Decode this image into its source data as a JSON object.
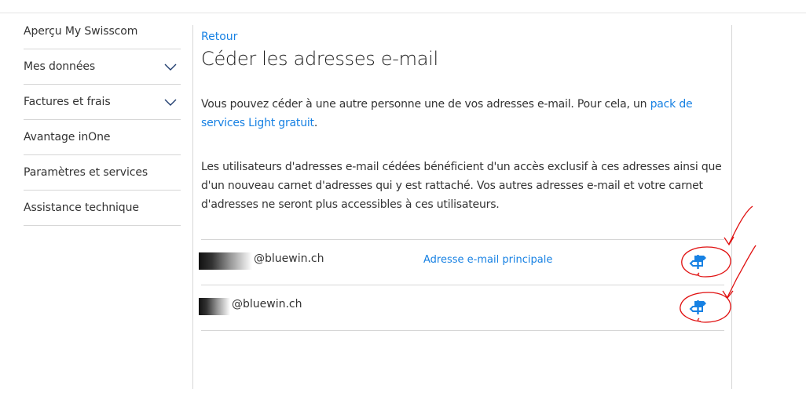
{
  "sidebar": {
    "items": [
      {
        "label": "Aperçu My Swisscom",
        "expandable": false
      },
      {
        "label": "Mes données",
        "expandable": true,
        "icon": "chevron-down-icon"
      },
      {
        "label": "Factures et frais",
        "expandable": true,
        "icon": "chevron-down-icon"
      },
      {
        "label": "Avantage inOne",
        "expandable": false
      },
      {
        "label": "Paramètres et services",
        "expandable": false
      },
      {
        "label": "Assistance technique",
        "expandable": false
      }
    ]
  },
  "main": {
    "back_link": "Retour",
    "title": "Céder les adresses e-mail",
    "para1_before": "Vous pouvez céder à une autre personne une de vos adresses e-mail. Pour cela, un ",
    "para1_link": "pack de services Light gratuit",
    "para1_after": ".",
    "para2": "Les utilisateurs d'adresses e-mail cédées bénéficient d'un accès exclusif à ces adresses ainsi que d'un nouveau carnet d'adresses qui y est rattaché. Vos autres adresses e-mail et votre carnet d'adresses ne seront plus accessibles à ces utilisateurs."
  },
  "emails": [
    {
      "address": "@bluewin.ch",
      "tag": "Adresse e-mail principale",
      "action_icon": "signpost-icon"
    },
    {
      "address": "@bluewin.ch",
      "tag": "",
      "action_icon": "signpost-icon"
    }
  ],
  "colors": {
    "link": "#1781e3",
    "text": "#333333",
    "divider": "#d6d6d6",
    "annotation": "#e01010"
  }
}
